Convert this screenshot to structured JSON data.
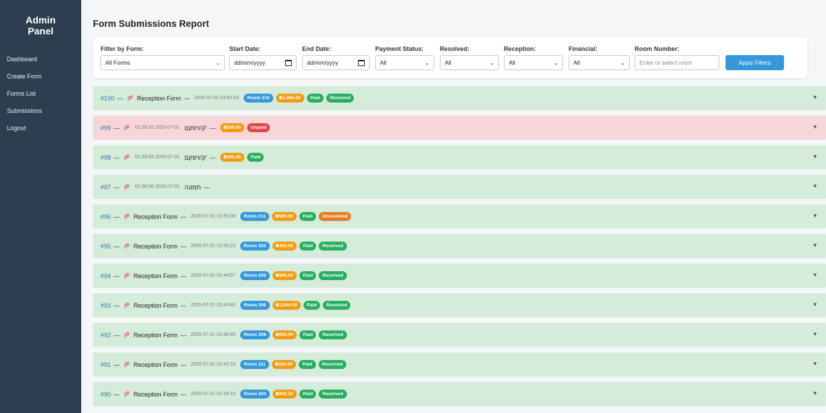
{
  "sidebar": {
    "brand_line1": "Admin",
    "brand_line2": "Panel",
    "items": [
      {
        "label": "Dashboard"
      },
      {
        "label": "Create Form"
      },
      {
        "label": "Forms List"
      },
      {
        "label": "Submissions"
      },
      {
        "label": "Logout"
      }
    ]
  },
  "page": {
    "title": "Form Submissions Report"
  },
  "filters": {
    "form": {
      "label": "Filter by Form:",
      "value": "All Forms"
    },
    "start_date": {
      "label": "Start Date:",
      "value": "dd/mm/yyyy"
    },
    "end_date": {
      "label": "End Date:",
      "value": "dd/mm/yyyy"
    },
    "payment": {
      "label": "Payment Status:",
      "value": "All"
    },
    "resolved": {
      "label": "Resolved:",
      "value": "All"
    },
    "reception": {
      "label": "Reception:",
      "value": "All"
    },
    "financial": {
      "label": "Financial:",
      "value": "All"
    },
    "room": {
      "label": "Room Number:",
      "placeholder": "Enter or select room"
    },
    "apply_label": "Apply Filters"
  },
  "colors": {
    "sidebar": "#2c3e50",
    "accent": "#3498db",
    "row_green": "#d4ecd9",
    "row_red": "#f7d6da"
  },
  "submissions": [
    {
      "id": "#100",
      "form": "Reception Form",
      "ts": "2025-07-01 03:50:03",
      "bg": "green",
      "badges": [
        {
          "t": "Room 210",
          "c": "room"
        },
        {
          "t": "฿1,000.00",
          "c": "amount"
        },
        {
          "t": "Paid",
          "c": "paid"
        },
        {
          "t": "Resolved",
          "c": "resolved"
        }
      ]
    },
    {
      "id": "#99",
      "form": "ק'ורפקם'",
      "ts": "02:29:16 2025-07-01",
      "bg": "red",
      "rtl": true,
      "badges": [
        {
          "t": "฿500.00",
          "c": "amount"
        },
        {
          "t": "Unpaid",
          "c": "unpaid"
        }
      ]
    },
    {
      "id": "#98",
      "form": "ק'ורפקם'",
      "ts": "02:29:03 2025-07-01",
      "bg": "green",
      "rtl": true,
      "badges": [
        {
          "t": "฿500.00",
          "c": "amount"
        },
        {
          "t": "Paid",
          "c": "paid"
        }
      ]
    },
    {
      "id": "#97",
      "form": "תמונה",
      "ts": "02:00:56 2025-07-01",
      "bg": "green",
      "rtl": true,
      "badges": []
    },
    {
      "id": "#96",
      "form": "Reception Form",
      "ts": "2025-07-01 01:55:38",
      "bg": "green",
      "badges": [
        {
          "t": "Room 211",
          "c": "room"
        },
        {
          "t": "฿500.00",
          "c": "amount"
        },
        {
          "t": "Paid",
          "c": "paid"
        },
        {
          "t": "Unresolved",
          "c": "unresolved"
        }
      ]
    },
    {
      "id": "#95",
      "form": "Reception Form",
      "ts": "2025-07-01 01:55:23",
      "bg": "green",
      "badges": [
        {
          "t": "Room 202",
          "c": "room"
        },
        {
          "t": "฿400.00",
          "c": "amount"
        },
        {
          "t": "Paid",
          "c": "paid"
        },
        {
          "t": "Resolved",
          "c": "resolved"
        }
      ]
    },
    {
      "id": "#94",
      "form": "Reception Form",
      "ts": "2025-07-01 01:44:57",
      "bg": "green",
      "badges": [
        {
          "t": "Room 205",
          "c": "room"
        },
        {
          "t": "฿500.00",
          "c": "amount"
        },
        {
          "t": "Paid",
          "c": "paid"
        },
        {
          "t": "Resolved",
          "c": "resolved"
        }
      ]
    },
    {
      "id": "#93",
      "form": "Reception Form",
      "ts": "2025-07-01 01:44:40",
      "bg": "green",
      "badges": [
        {
          "t": "Room 206",
          "c": "room"
        },
        {
          "t": "฿2,000.00",
          "c": "amount"
        },
        {
          "t": "Paid",
          "c": "paid"
        },
        {
          "t": "Resolved",
          "c": "resolved"
        }
      ]
    },
    {
      "id": "#92",
      "form": "Reception Form",
      "ts": "2025-07-01 01:40:45",
      "bg": "green",
      "badges": [
        {
          "t": "Room 208",
          "c": "room"
        },
        {
          "t": "฿500.00",
          "c": "amount"
        },
        {
          "t": "Paid",
          "c": "paid"
        },
        {
          "t": "Resolved",
          "c": "resolved"
        }
      ]
    },
    {
      "id": "#91",
      "form": "Reception Form",
      "ts": "2025-07-01 01:40:18",
      "bg": "green",
      "badges": [
        {
          "t": "Room 111",
          "c": "room"
        },
        {
          "t": "฿500.00",
          "c": "amount"
        },
        {
          "t": "Paid",
          "c": "paid"
        },
        {
          "t": "Resolved",
          "c": "resolved"
        }
      ]
    },
    {
      "id": "#90",
      "form": "Reception Form",
      "ts": "2025-07-01 01:35:10",
      "bg": "green",
      "badges": [
        {
          "t": "Room 204",
          "c": "room"
        },
        {
          "t": "฿600.00",
          "c": "amount"
        },
        {
          "t": "Paid",
          "c": "paid"
        },
        {
          "t": "Resolved",
          "c": "resolved"
        }
      ]
    }
  ]
}
